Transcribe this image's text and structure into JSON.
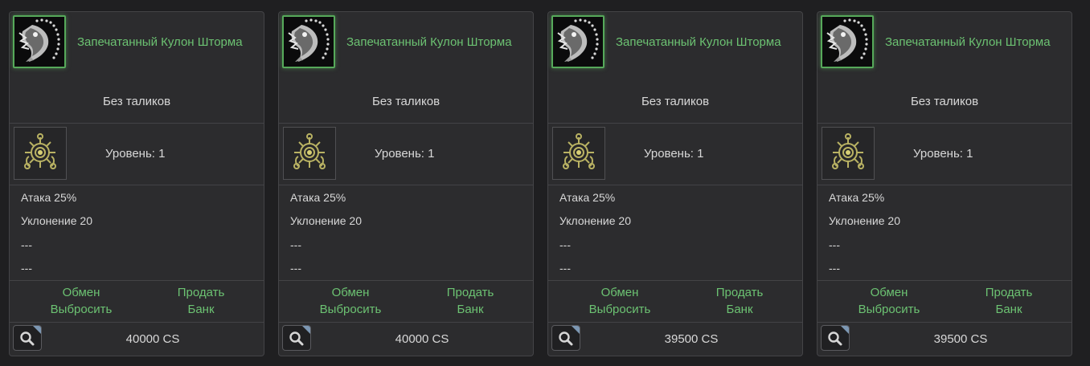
{
  "accent_color": "#6cc272",
  "cards": [
    {
      "item_name": "Запечатанный Кулон Шторма",
      "item_icon": "storm-pendant-icon",
      "taliks": "Без таликов",
      "level": "Уровень: 1",
      "stats": [
        "Атака 25%",
        "Уклонение 20",
        "---",
        "---"
      ],
      "actions": {
        "exchange": "Обмен",
        "sell": "Продать",
        "drop": "Выбросить",
        "bank": "Банк"
      },
      "price": "40000 CS"
    },
    {
      "item_name": "Запечатанный Кулон Шторма",
      "item_icon": "storm-pendant-icon",
      "taliks": "Без таликов",
      "level": "Уровень: 1",
      "stats": [
        "Атака 25%",
        "Уклонение 20",
        "---",
        "---"
      ],
      "actions": {
        "exchange": "Обмен",
        "sell": "Продать",
        "drop": "Выбросить",
        "bank": "Банк"
      },
      "price": "40000 CS"
    },
    {
      "item_name": "Запечатанный Кулон Шторма",
      "item_icon": "storm-pendant-icon",
      "taliks": "Без таликов",
      "level": "Уровень: 1",
      "stats": [
        "Атака 25%",
        "Уклонение 20",
        "---",
        "---"
      ],
      "actions": {
        "exchange": "Обмен",
        "sell": "Продать",
        "drop": "Выбросить",
        "bank": "Банк"
      },
      "price": "39500 CS"
    },
    {
      "item_name": "Запечатанный Кулон Шторма",
      "item_icon": "storm-pendant-icon",
      "taliks": "Без таликов",
      "level": "Уровень: 1",
      "stats": [
        "Атака 25%",
        "Уклонение 20",
        "---",
        "---"
      ],
      "actions": {
        "exchange": "Обмен",
        "sell": "Продать",
        "drop": "Выбросить",
        "bank": "Банк"
      },
      "price": "39500 CS"
    }
  ]
}
